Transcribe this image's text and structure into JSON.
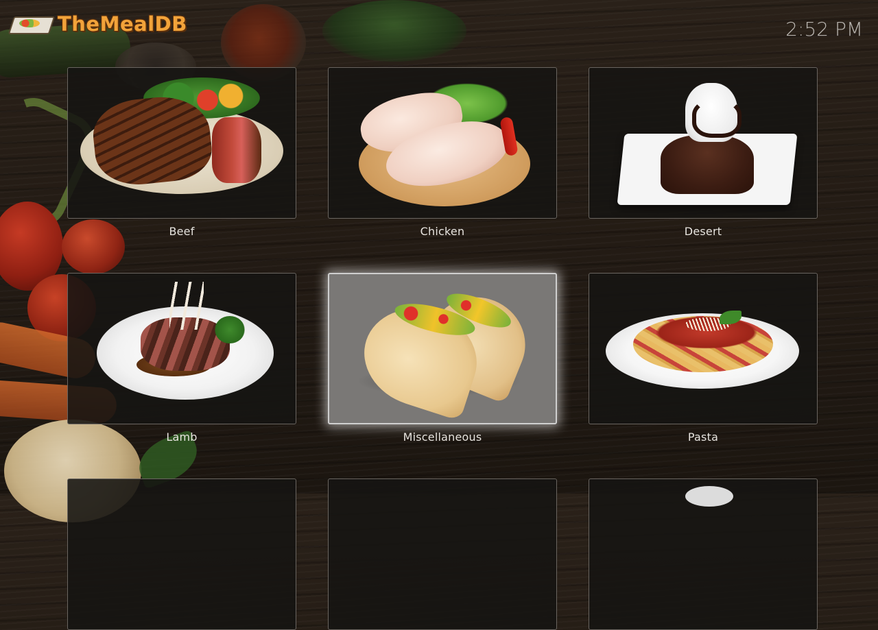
{
  "app": {
    "logo_text": "TheMealDB",
    "clock": "2:52 PM"
  },
  "categories": [
    {
      "label": "Beef",
      "icon": "beef-steak-image",
      "focused": false
    },
    {
      "label": "Chicken",
      "icon": "chicken-legs-image",
      "focused": false
    },
    {
      "label": "Desert",
      "icon": "chocolate-dessert-image",
      "focused": false
    },
    {
      "label": "Lamb",
      "icon": "lamb-chops-image",
      "focused": false
    },
    {
      "label": "Miscellaneous",
      "icon": "tacos-image",
      "focused": true
    },
    {
      "label": "Pasta",
      "icon": "penne-pasta-image",
      "focused": false
    }
  ],
  "colors": {
    "logo": "#f2a33a",
    "focus_tile": "#7a7876",
    "label_text": "#e7e4df",
    "clock_text": "#b9b5b0"
  }
}
